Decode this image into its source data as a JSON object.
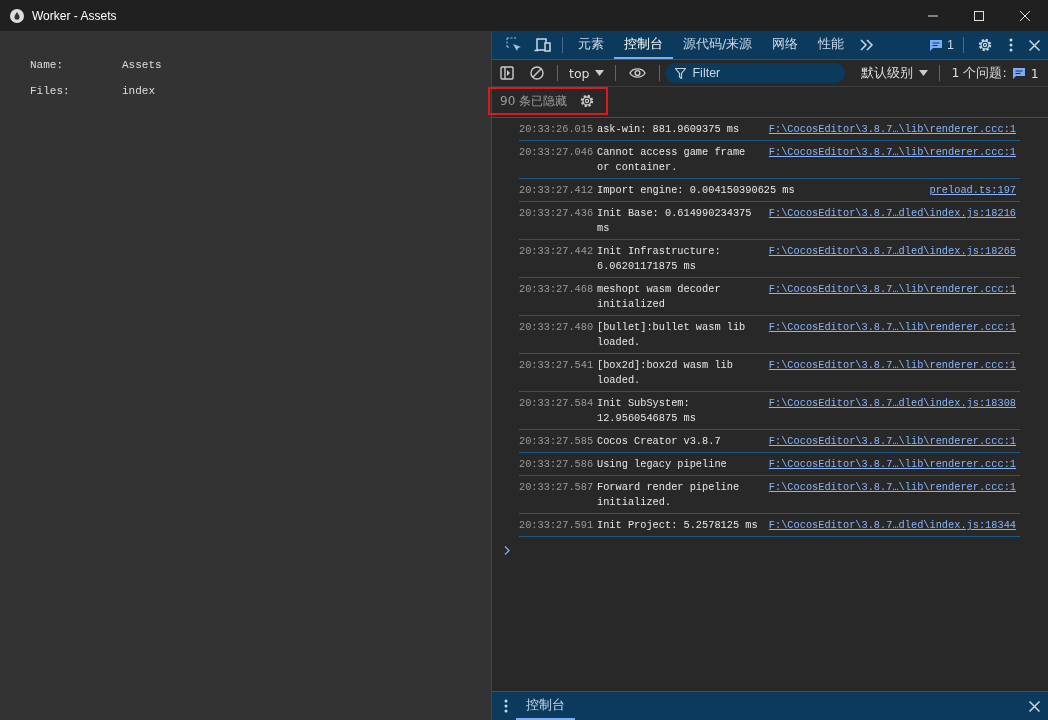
{
  "window": {
    "title": "Worker - Assets"
  },
  "info": [
    {
      "label": "Name:",
      "value": "Assets"
    },
    {
      "label": "Files:",
      "value": "index"
    }
  ],
  "devtools": {
    "tabs": [
      {
        "label": "元素",
        "selected": false
      },
      {
        "label": "控制台",
        "selected": true
      },
      {
        "label": "源代码/来源",
        "selected": false
      },
      {
        "label": "网络",
        "selected": false
      },
      {
        "label": "性能",
        "selected": false
      }
    ],
    "message_count": "1",
    "console_toolbar": {
      "context": "top",
      "filter_placeholder": "Filter",
      "level": "默认级别",
      "issues_label": "1 个问题:",
      "issues_count": "1"
    },
    "hidden_notice": {
      "text": "90 条已隐藏",
      "highlighted": true
    },
    "logs": [
      {
        "time": "20:33:26.015",
        "message": "ask-win: 881.9609375 ms",
        "source": "F:\\CocosEditor\\3.8.7…\\lib\\renderer.ccc:1"
      },
      {
        "time": "20:33:27.046",
        "message": "Cannot access game frame or container.",
        "source": "F:\\CocosEditor\\3.8.7…\\lib\\renderer.ccc:1"
      },
      {
        "time": "20:33:27.412",
        "message": "Import engine: 0.004150390625 ms",
        "source": "preload.ts:197"
      },
      {
        "time": "20:33:27.436",
        "message": "Init Base: 0.614990234375 ms",
        "source": "F:\\CocosEditor\\3.8.7…dled\\index.js:18216"
      },
      {
        "time": "20:33:27.442",
        "message": "Init Infrastructure: 6.06201171875 ms",
        "source": "F:\\CocosEditor\\3.8.7…dled\\index.js:18265"
      },
      {
        "time": "20:33:27.468",
        "message": "meshopt wasm decoder initialized",
        "source": "F:\\CocosEditor\\3.8.7…\\lib\\renderer.ccc:1"
      },
      {
        "time": "20:33:27.480",
        "message": "[bullet]:bullet wasm lib loaded.",
        "source": "F:\\CocosEditor\\3.8.7…\\lib\\renderer.ccc:1"
      },
      {
        "time": "20:33:27.541",
        "message": "[box2d]:box2d wasm lib loaded.",
        "source": "F:\\CocosEditor\\3.8.7…\\lib\\renderer.ccc:1"
      },
      {
        "time": "20:33:27.584",
        "message": "Init SubSystem: 12.9560546875 ms",
        "source": "F:\\CocosEditor\\3.8.7…dled\\index.js:18308"
      },
      {
        "time": "20:33:27.585",
        "message": "Cocos Creator v3.8.7",
        "source": "F:\\CocosEditor\\3.8.7…\\lib\\renderer.ccc:1"
      },
      {
        "time": "20:33:27.586",
        "message": "Using legacy pipeline",
        "source": "F:\\CocosEditor\\3.8.7…\\lib\\renderer.ccc:1"
      },
      {
        "time": "20:33:27.587",
        "message": "Forward render pipeline initialized.",
        "source": "F:\\CocosEditor\\3.8.7…\\lib\\renderer.ccc:1"
      },
      {
        "time": "20:33:27.591",
        "message": "Init Project: 5.2578125 ms",
        "source": "F:\\CocosEditor\\3.8.7…dled\\index.js:18344"
      }
    ],
    "drawer_tabs": [
      {
        "label": "控制台",
        "selected": true
      }
    ]
  }
}
